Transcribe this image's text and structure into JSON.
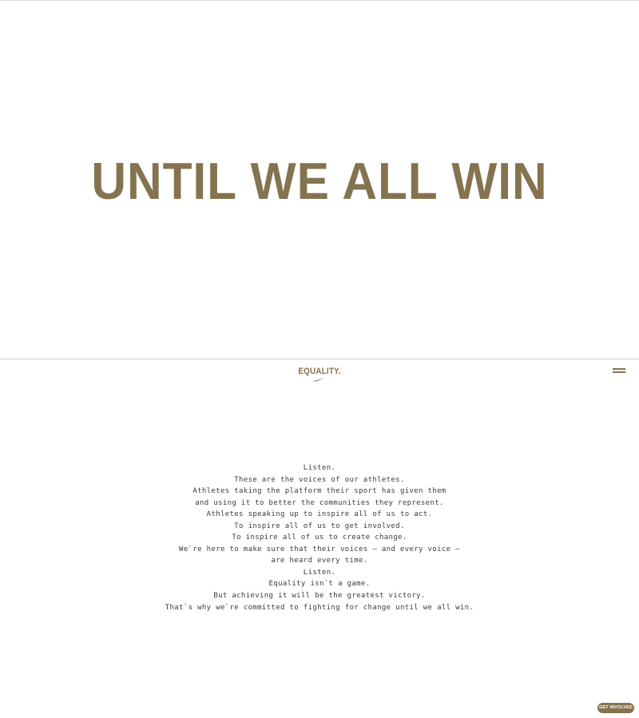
{
  "hero": {
    "title": "UNTIL WE ALL WIN"
  },
  "nav": {
    "logo_text": "EQUALITY.",
    "logo_icon": "swoosh-icon",
    "menu_icon": "hamburger-menu-icon"
  },
  "manifesto": {
    "lines": [
      "Listen.",
      "These are the voices of our athletes.",
      "Athletes taking the platform their sport has given them",
      "and using it to better the communities they represent.",
      "Athletes speaking up to inspire all of us to act.",
      "To inspire all of us to get involved.",
      "To inspire all of us to create change.",
      "We`re here to make sure that their voices – and every voice –",
      "are heard every time.",
      "Listen.",
      "Equality isn`t a game.",
      "But achieving it will be the greatest victory.",
      "That`s why we`re committed to fighting for change until we all win."
    ]
  },
  "cta": {
    "label": "GET INVOLVED"
  },
  "colors": {
    "brand_gold": "#857350",
    "body_text": "#3b3b3b",
    "background": "#ffffff",
    "rule": "#cfcfcf"
  }
}
